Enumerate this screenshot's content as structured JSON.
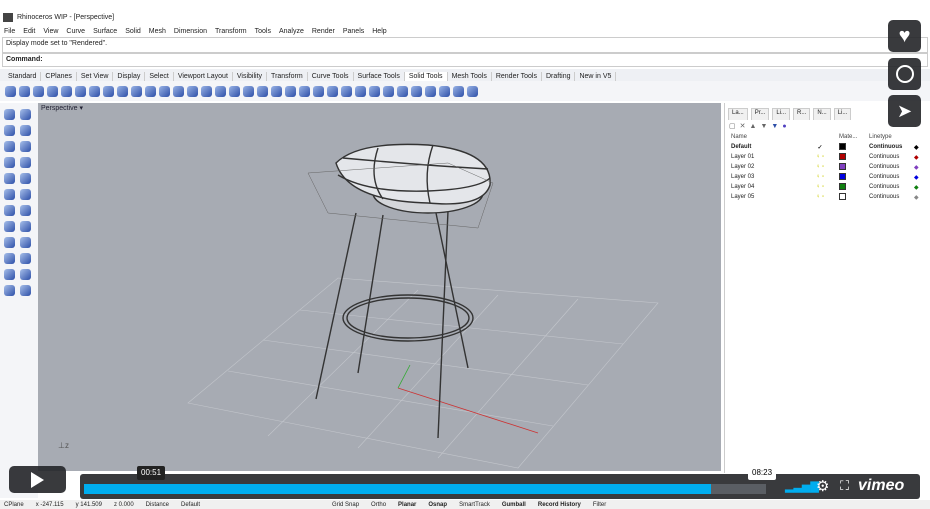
{
  "window": {
    "title": "Rhinoceros WIP - [Perspective]"
  },
  "menu": [
    "File",
    "Edit",
    "View",
    "Curve",
    "Surface",
    "Solid",
    "Mesh",
    "Dimension",
    "Transform",
    "Tools",
    "Analyze",
    "Render",
    "Panels",
    "Help"
  ],
  "command_history": "Display mode set to \"Rendered\".",
  "command_prompt": "Command:",
  "toolbar_tabs": [
    "Standard",
    "CPlanes",
    "Set View",
    "Display",
    "Select",
    "Viewport Layout",
    "Visibility",
    "Transform",
    "Curve Tools",
    "Surface Tools",
    "Solid Tools",
    "Mesh Tools",
    "Render Tools",
    "Drafting",
    "New in V5"
  ],
  "active_tab": "Solid Tools",
  "viewport": {
    "label": "Perspective"
  },
  "panel": {
    "tabs": [
      "La...",
      "Pr...",
      "Li...",
      "R...",
      "N...",
      "Li..."
    ],
    "headers": {
      "name": "Name",
      "material": "Mate...",
      "linetype": "Linetype"
    },
    "layers": [
      {
        "name": "Default",
        "current": "✓",
        "color": "#000000",
        "linetype": "Continuous"
      },
      {
        "name": "Layer 01",
        "color": "#b00000",
        "linetype": "Continuous"
      },
      {
        "name": "Layer 02",
        "color": "#8040c0",
        "linetype": "Continuous"
      },
      {
        "name": "Layer 03",
        "color": "#0000e0",
        "linetype": "Continuous"
      },
      {
        "name": "Layer 04",
        "color": "#108010",
        "linetype": "Continuous"
      },
      {
        "name": "Layer 05",
        "color": "#ffffff",
        "linetype": "Continuous"
      }
    ]
  },
  "status": {
    "cplane": "CPlane",
    "x": "x -247.115",
    "y": "y 141.509",
    "z": "z 0.000",
    "distance": "Distance",
    "layer": "Default",
    "toggles": [
      "Grid Snap",
      "Ortho",
      "Planar",
      "Osnap",
      "SmartTrack",
      "Gumball",
      "Record History",
      "Filter"
    ]
  },
  "player": {
    "current_time": "00:51",
    "hover_time": "08:23",
    "progress": 0.92,
    "brand": "vimeo",
    "accent": "#00adef"
  }
}
